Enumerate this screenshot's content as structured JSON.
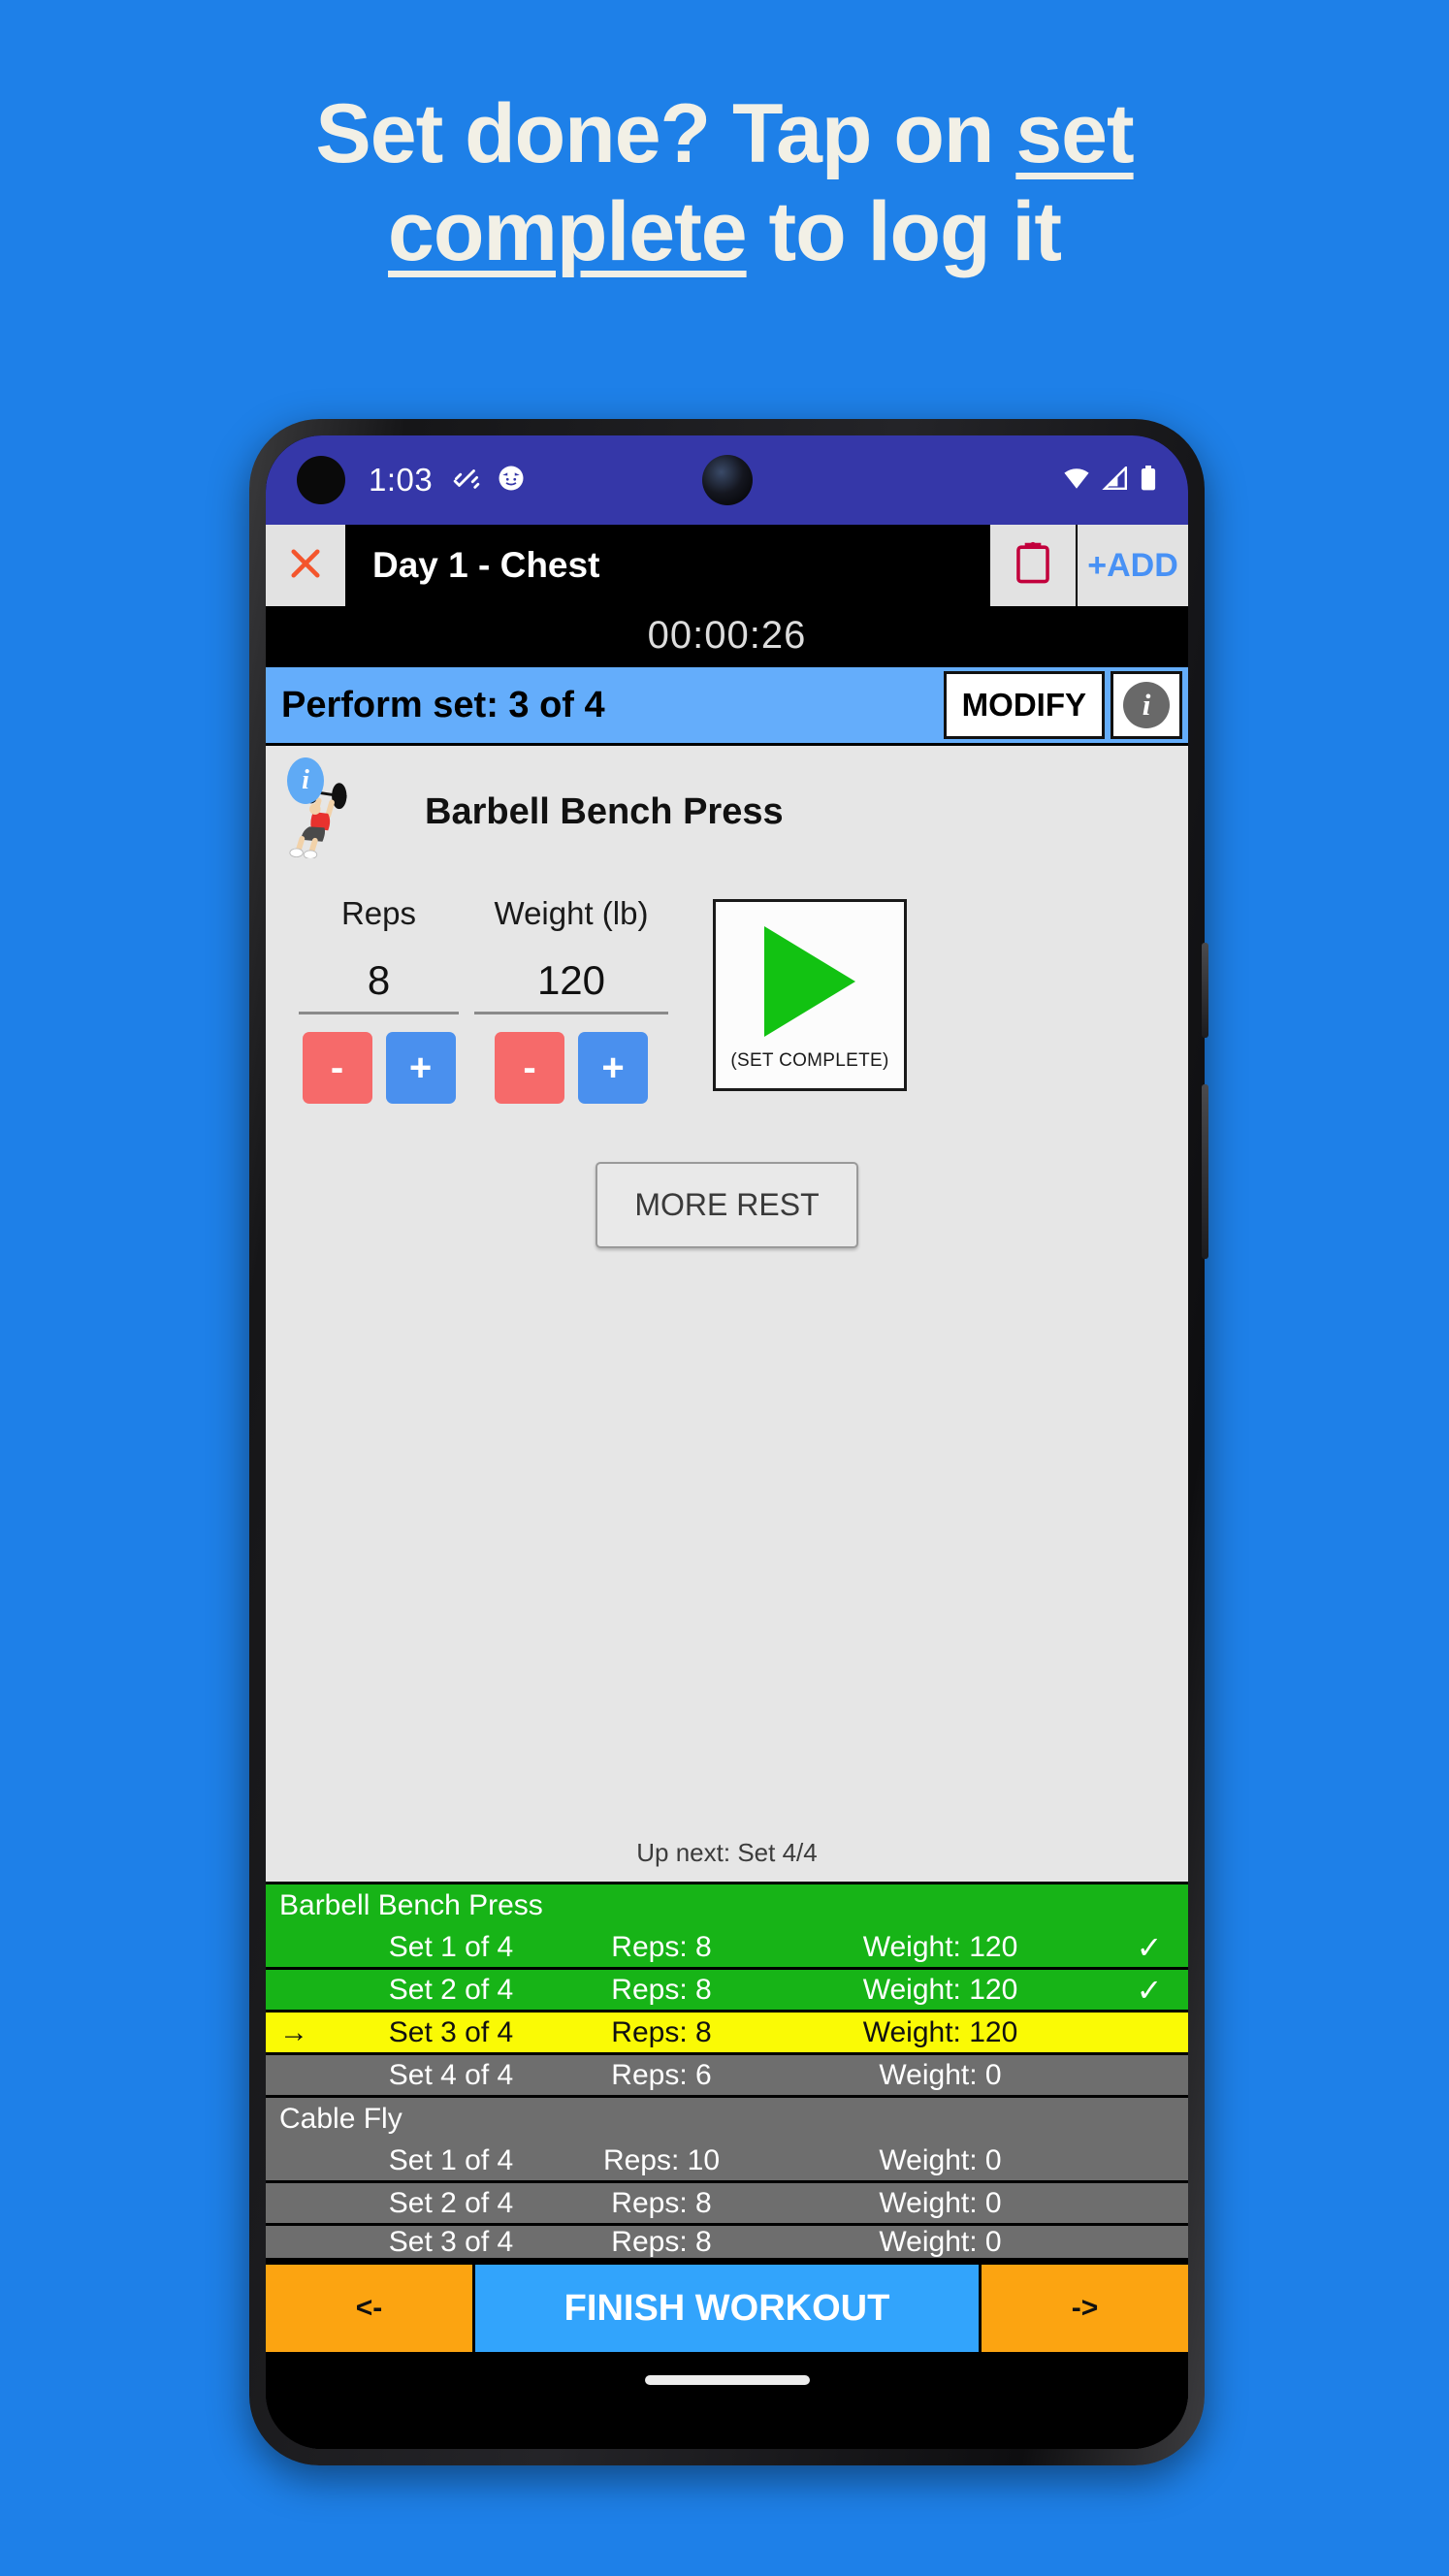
{
  "promo": {
    "line1_a": "Set done? Tap on ",
    "line1_u": "set",
    "line2_u": "complete",
    "line2_b": " to log it",
    "bg_color": "#1E80E8",
    "text_color": "#F2F0E6"
  },
  "status_bar": {
    "time": "1:03",
    "icons_left": [
      "dumbbell-icon",
      "face-emoji-icon"
    ],
    "icons_right": [
      "wifi-icon",
      "cellular-signal-icon",
      "battery-icon"
    ],
    "bg_color": "#3537A8"
  },
  "toolbar": {
    "close_icon": "close-x-icon",
    "title": "Day 1 - Chest",
    "clipboard_icon": "clipboard-icon",
    "add_label": "+ADD",
    "add_color": "#4891F5",
    "clipboard_color": "#C2003C"
  },
  "timer": {
    "value": "00:00:26"
  },
  "perform_bar": {
    "label": "Perform set: 3 of 4",
    "modify_label": "MODIFY",
    "info_icon": "info-icon",
    "info_glyph": "i",
    "bg_color": "#64ADFB"
  },
  "exercise": {
    "info_badge_glyph": "i",
    "thumbnail": "bench-press-illustration",
    "name": "Barbell Bench Press"
  },
  "reps": {
    "label": "Reps",
    "value": "8",
    "minus_label": "-",
    "plus_label": "+"
  },
  "weight": {
    "label": "Weight (lb)",
    "value": "120",
    "minus_label": "-",
    "plus_label": "+"
  },
  "set_complete": {
    "icon": "play-triangle-icon",
    "caption": "(SET COMPLETE)",
    "triangle_color": "#12C212"
  },
  "more_rest": {
    "label": "MORE REST"
  },
  "up_next": {
    "label": "Up next: Set 4/4"
  },
  "set_list": {
    "groups": [
      {
        "exercise": "Barbell Bench Press",
        "state": "green",
        "rows": [
          {
            "arrow": "",
            "set": "Set 1 of 4",
            "reps": "Reps: 8",
            "weight": "Weight: 120",
            "check": "✓",
            "state": "green"
          },
          {
            "arrow": "",
            "set": "Set 2 of 4",
            "reps": "Reps: 8",
            "weight": "Weight: 120",
            "check": "✓",
            "state": "green"
          },
          {
            "arrow": "→",
            "set": "Set 3 of 4",
            "reps": "Reps: 8",
            "weight": "Weight: 120",
            "check": "",
            "state": "yellow"
          },
          {
            "arrow": "",
            "set": "Set 4 of 4",
            "reps": "Reps: 6",
            "weight": "Weight: 0",
            "check": "",
            "state": "grey"
          }
        ]
      },
      {
        "exercise": "Cable Fly",
        "state": "grey",
        "rows": [
          {
            "arrow": "",
            "set": "Set 1 of 4",
            "reps": "Reps: 10",
            "weight": "Weight: 0",
            "check": "",
            "state": "grey"
          },
          {
            "arrow": "",
            "set": "Set 2 of 4",
            "reps": "Reps: 8",
            "weight": "Weight: 0",
            "check": "",
            "state": "grey"
          },
          {
            "arrow": "",
            "set": "Set 3 of 4",
            "reps": "Reps: 8",
            "weight": "Weight: 0",
            "check": "",
            "state": "grey"
          }
        ]
      }
    ],
    "colors": {
      "done": "#17B417",
      "active": "#FAFA05",
      "pending": "#6E6E6E"
    }
  },
  "bottom_nav": {
    "prev_label": "<-",
    "finish_label": "FINISH WORKOUT",
    "next_label": "->",
    "prev_color": "#FCA411",
    "finish_color": "#32A4FC"
  }
}
